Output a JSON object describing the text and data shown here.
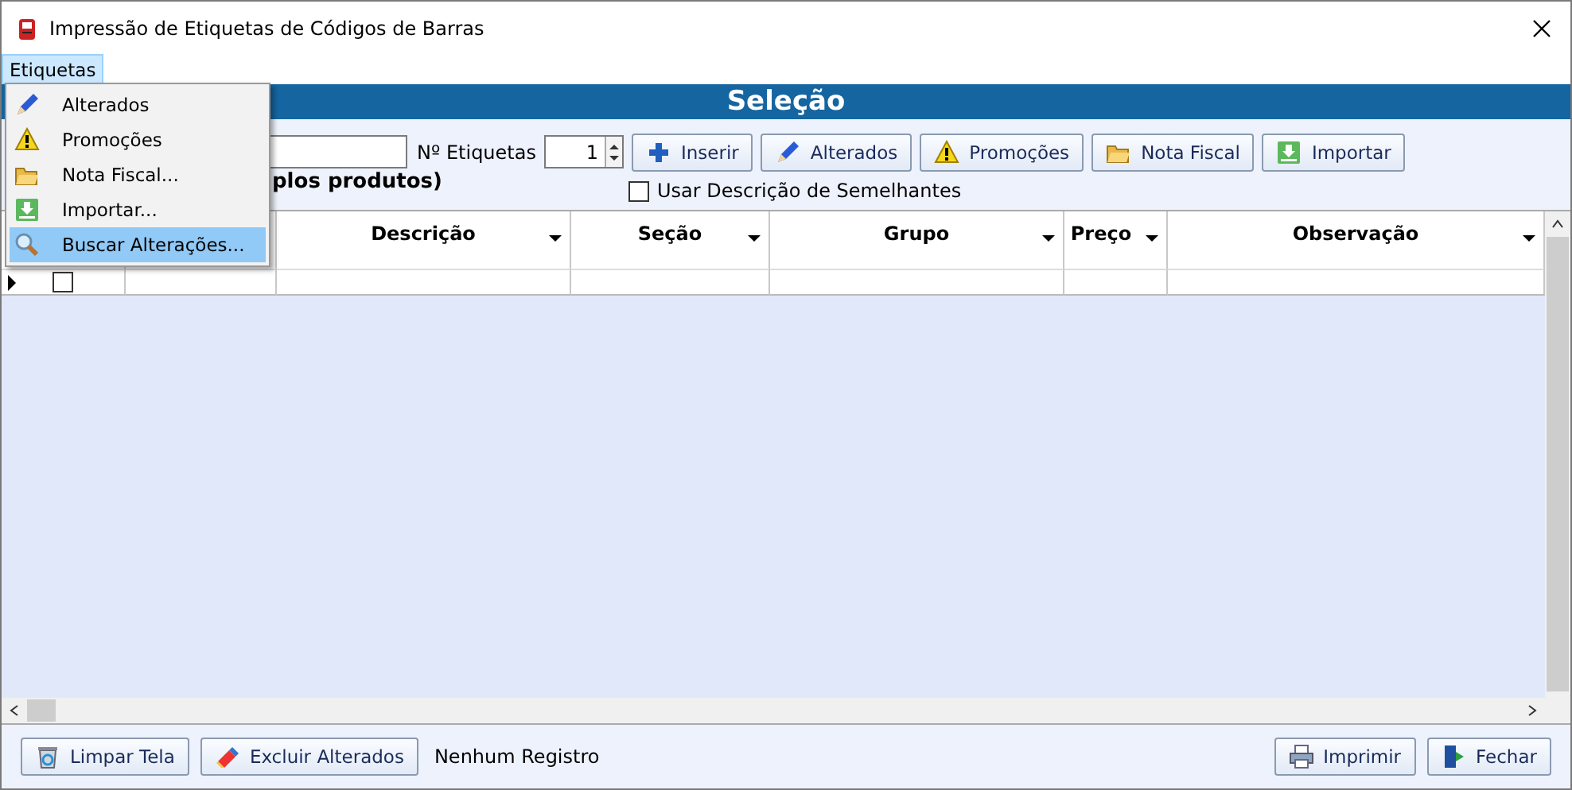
{
  "window": {
    "title": "Impressão de Etiquetas de Códigos de Barras"
  },
  "menu_bar": [
    {
      "label": "Etiquetas",
      "selected": true
    }
  ],
  "dropdown": [
    {
      "label": "Alterados",
      "kind": "pencil",
      "selected": false
    },
    {
      "label": "Promoções",
      "kind": "warning",
      "selected": false
    },
    {
      "label": "Nota Fiscal...",
      "kind": "folder",
      "selected": false
    },
    {
      "label": "Importar...",
      "kind": "download",
      "selected": false
    },
    {
      "label": "Buscar Alterações...",
      "kind": "search",
      "selected": true
    }
  ],
  "header": {
    "title": "Seleção"
  },
  "toolbar": {
    "hint": "plos produtos)",
    "quantity_label": "Nº Etiquetas",
    "quantity": "1",
    "buttons": [
      {
        "label": "Inserir",
        "kind": "plus"
      },
      {
        "label": "Alterados",
        "kind": "pencil"
      },
      {
        "label": "Promoções",
        "kind": "warning"
      },
      {
        "label": "Nota Fiscal",
        "kind": "folder"
      },
      {
        "label": "Importar",
        "kind": "download"
      }
    ],
    "similar": {
      "label": "Usar Descrição de Semelhantes",
      "checked": false
    }
  },
  "grid": {
    "columns": [
      {
        "label": "Descrição"
      },
      {
        "label": "Seção"
      },
      {
        "label": "Grupo"
      },
      {
        "label": "Preço"
      },
      {
        "label": "Observação"
      }
    ],
    "rows": [
      {
        "checked": false
      }
    ]
  },
  "bottom": {
    "left_buttons": [
      {
        "label": "Limpar Tela",
        "kind": "recycle"
      },
      {
        "label": "Excluir Alterados",
        "kind": "eraser"
      }
    ],
    "status": "Nenhum Registro",
    "right_buttons": [
      {
        "label": "Imprimir",
        "kind": "printer"
      },
      {
        "label": "Fechar",
        "kind": "exit"
      }
    ]
  }
}
